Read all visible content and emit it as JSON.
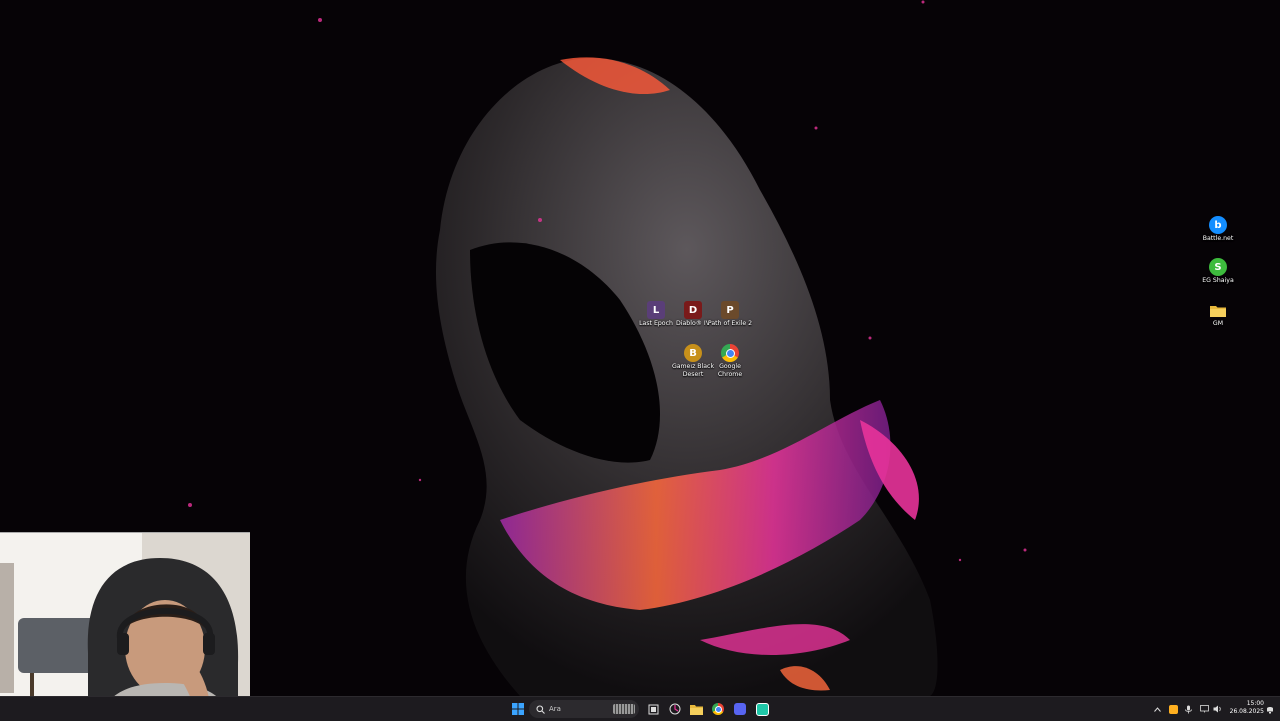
{
  "desktop": {
    "center_icons": [
      {
        "label": "Last Epoch",
        "icon": "last-epoch-icon",
        "color": "#5a3e78"
      },
      {
        "label": "Diablo® IV",
        "icon": "diablo-icon",
        "color": "#7a1a1a"
      },
      {
        "label": "Path of Exile 2",
        "icon": "path-of-exile-icon",
        "color": "#6b4a2b"
      },
      {
        "label": "Gameız Black Desert",
        "icon": "black-desert-icon",
        "color": "#c7901a"
      },
      {
        "label": "Google Chrome",
        "icon": "chrome-icon",
        "color": "#4285f4"
      }
    ],
    "right_icons": [
      {
        "label": "Battle.net",
        "icon": "battlenet-icon",
        "color": "#148eff"
      },
      {
        "label": "EG Shaiya",
        "icon": "shaiya-icon",
        "color": "#3dbb3d"
      },
      {
        "label": "GM",
        "icon": "folder-icon",
        "color": "#e8b93c"
      }
    ]
  },
  "taskbar": {
    "search_placeholder": "Ara",
    "pinned": [
      "start-icon",
      "search-icon",
      "widgets-icon",
      "task-view-icon",
      "snipping-icon",
      "chrome-icon",
      "file-explorer-icon",
      "discord-icon",
      "app-icon"
    ],
    "clock_time": "15:00",
    "clock_date": "26.08.2025"
  },
  "colors": {
    "wallpaper_bg": "#060306",
    "taskbar_bg": "#1d1b1f",
    "accent_pink": "#e8339a",
    "accent_orange": "#ff6a3d"
  }
}
